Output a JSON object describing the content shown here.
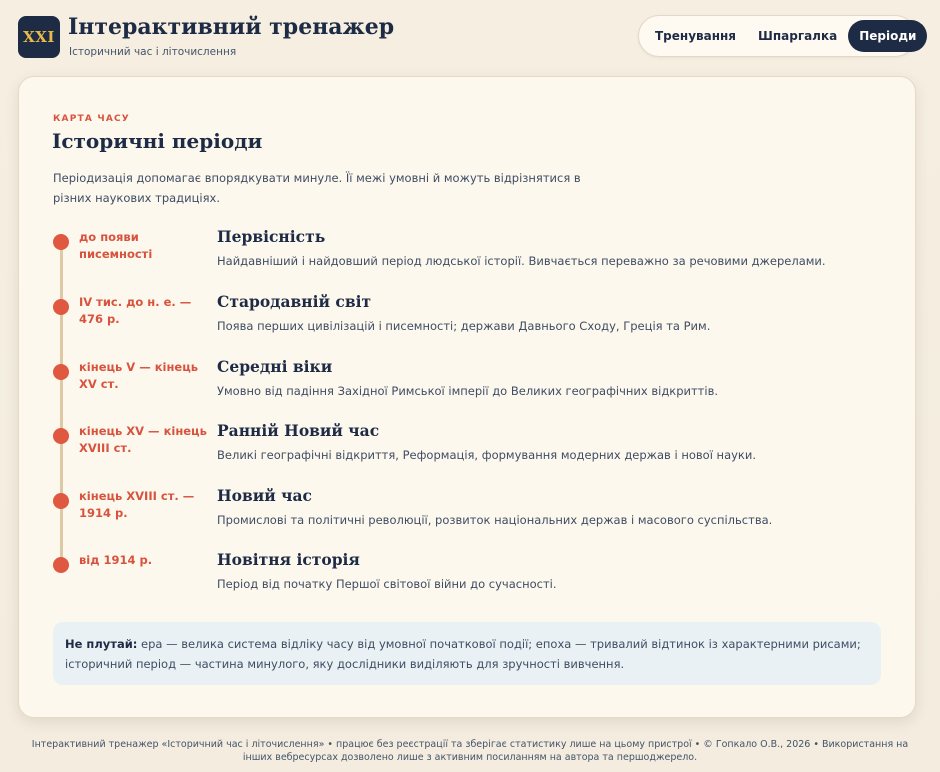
{
  "header": {
    "logo_text": "XXI",
    "title": "Інтерактивний тренажер",
    "subtitle": "Історичний час і літочислення"
  },
  "nav": {
    "items": [
      {
        "label": "Тренування"
      },
      {
        "label": "Шпаргалка"
      },
      {
        "label": "Періоди",
        "active": true
      }
    ]
  },
  "card": {
    "kicker": "КАРТА ЧАСУ",
    "title": "Історичні періоди",
    "intro": "Періодизація допомагає впорядкувати минуле. Її межі умовні й можуть відрізнятися в різних наукових традиціях."
  },
  "timeline": [
    {
      "date": "до появи писемності",
      "name": "Первісність",
      "desc": "Найдавніший і найдовший період людської історії. Вивчається переважно за речовими джерелами."
    },
    {
      "date": "IV тис. до н. е. — 476 р.",
      "name": "Стародавній світ",
      "desc": "Поява перших цивілізацій і писемності; держави Давнього Сходу, Греція та Рим."
    },
    {
      "date": "кінець V — кінець XV ст.",
      "name": "Середні віки",
      "desc": "Умовно від падіння Західної Римської імперії до Великих географічних відкриттів."
    },
    {
      "date": "кінець XV — кінець XVIII ст.",
      "name": "Ранній Новий час",
      "desc": "Великі географічні відкриття, Реформація, формування модерних держав і нової науки."
    },
    {
      "date": "кінець XVIII ст. — 1914 р.",
      "name": "Новий час",
      "desc": "Промислові та політичні революції, розвиток національних держав і масового суспільства."
    },
    {
      "date": "від 1914 р.",
      "name": "Новітня історія",
      "desc": "Період від початку Першої світової війни до сучасності."
    }
  ],
  "note": {
    "label": "Не плутай:",
    "text": " ера — велика система відліку часу від умовної початкової події; епоха — тривалий відтинок із характерними рисами; історичний період — частина минулого, яку дослідники виділяють для зручності вивчення."
  },
  "footer": {
    "text": "Інтерактивний тренажер «Історичний час і літочислення» • працює без реєстрації та зберігає статистику лише на цьому пристрої • © Гопкало О.В., 2026 • Використання на інших вебресурсах дозволено лише з активним посиланням на автора та першоджерело."
  },
  "colors": {
    "accent": "#e0583f",
    "navy": "#1d2b45",
    "gold": "#e9b949"
  }
}
